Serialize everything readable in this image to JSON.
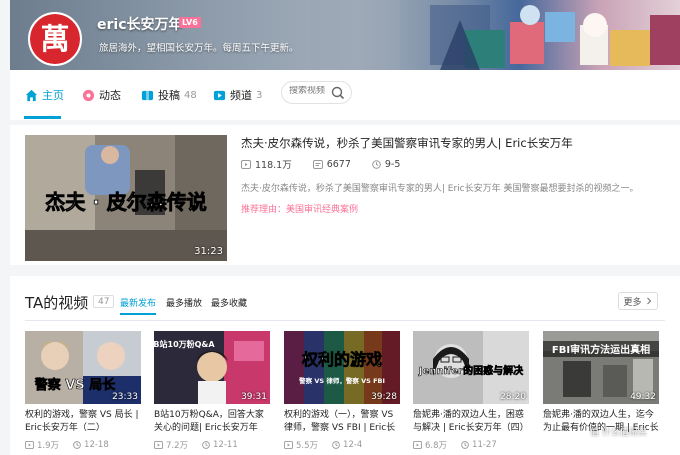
{
  "profile": {
    "username": "eric长安万年",
    "level": "LV6",
    "avatar_glyph": "萬",
    "signature": "旅居海外，望相国长安万年。每周五下午更新。"
  },
  "nav": {
    "home": "主页",
    "dynamic": "动态",
    "posts": "投稿",
    "posts_count": "48",
    "channels": "频道",
    "channels_count": "3",
    "search_placeholder": "搜索视频"
  },
  "featured": {
    "title": "杰夫·皮尔森传说，秒杀了美国警察审讯专家的男人| Eric长安万年",
    "thumb_text": "杰夫 · 皮尔森传说",
    "duration": "31:23",
    "plays": "118.1万",
    "danmaku": "6677",
    "date": "9-5",
    "description": "杰夫·皮尔森传说，秒杀了美国警察审讯专家的男人| Eric长安万年 美国警察最想要封杀的视频之一。",
    "recommend": "推荐理由：美国审讯经典案例"
  },
  "videos_section": {
    "title": "TA的视频",
    "count": "47",
    "tabs": [
      "最新发布",
      "最多播放",
      "最多收藏"
    ],
    "more": "更多"
  },
  "videos": [
    {
      "thumb_text": "警察 VS 局长",
      "duration": "23:33",
      "title": "权利的游戏，警察 VS 局长 | Eric长安万年（二）",
      "plays": "1.9万",
      "date": "12-18"
    },
    {
      "thumb_text": "B站10万粉Q&A",
      "duration": "39:31",
      "title": "B站10万粉Q&A，回答大家关心的问题| Eric长安万年",
      "plays": "7.2万",
      "date": "12-11"
    },
    {
      "thumb_text": "权利的游戏",
      "thumb_sub": "警察 VS 律师，警察 VS FBI",
      "duration": "39:28",
      "title": "权利的游戏（一），警察 VS 律师，警察 VS FBI | Eric长安",
      "plays": "5.5万",
      "date": "12-4"
    },
    {
      "thumb_text": "Jennifer的困惑与解决",
      "duration": "28:20",
      "title": "詹妮弗·潘的双边人生，困惑与解决 | Eric长安万年（四）",
      "plays": "6.8万",
      "date": "11-27"
    },
    {
      "thumb_text": "FBI审讯方法运出真相",
      "duration": "49:32",
      "title": "詹妮弗·潘的双边人生，迄今为止最有价值的一期 | Eric长安",
      "plays": "",
      "date": ""
    }
  ],
  "watermark": "值 什么值得买",
  "colors": {
    "accent": "#00a1d6",
    "pink": "#fb7299",
    "avatar_red": "#d7262d"
  }
}
